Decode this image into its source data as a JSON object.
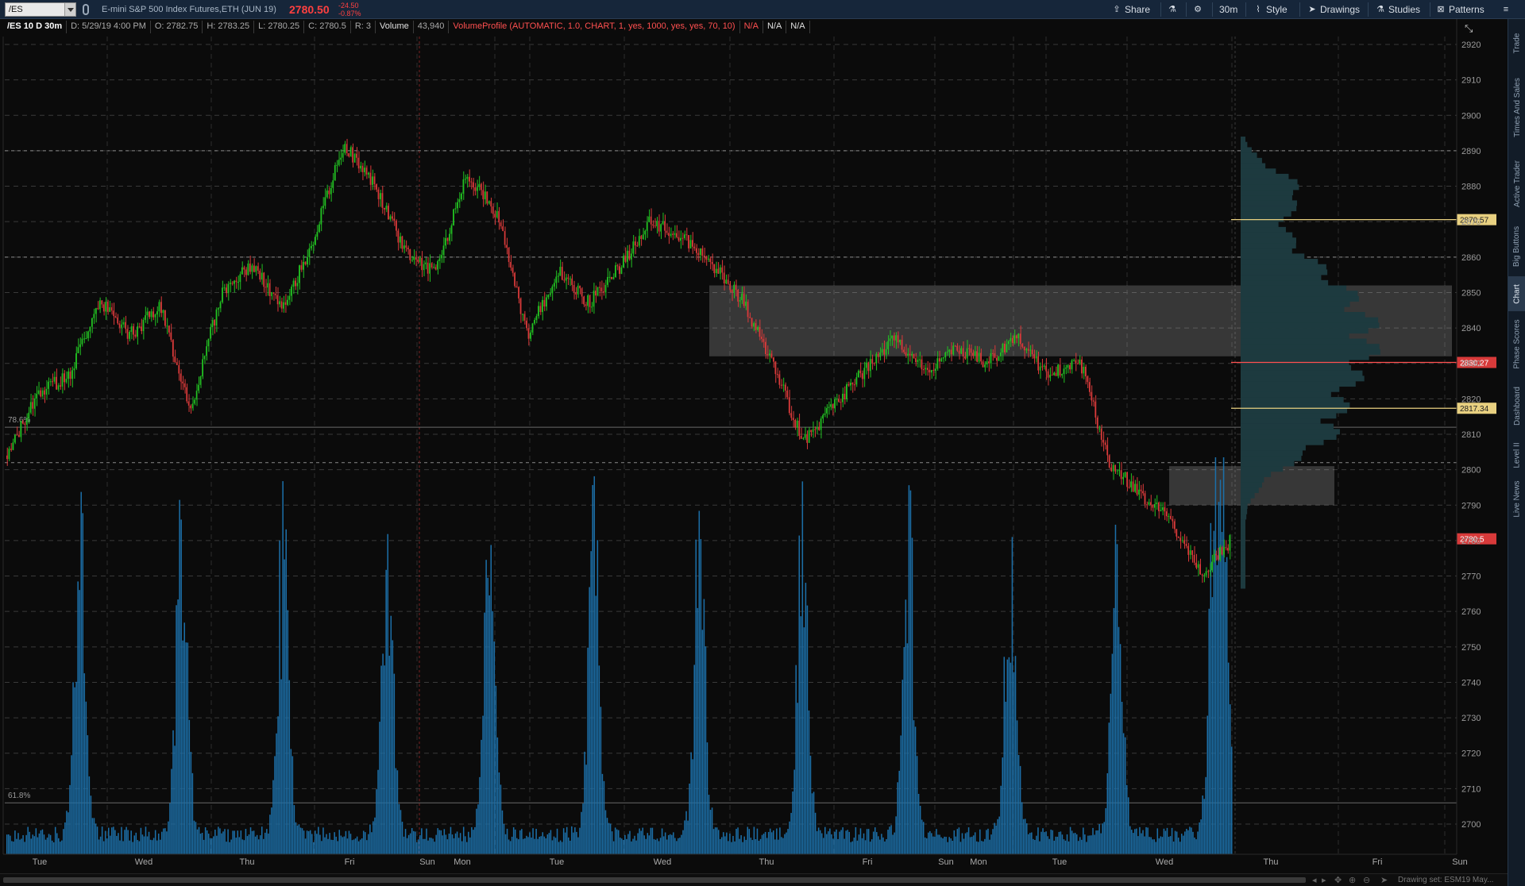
{
  "toolbar": {
    "symbol_input": "/ES",
    "symbol_description": "E-mini S&P 500 Index Futures,ETH (JUN 19)",
    "last_price": "2780.50",
    "net_change": "-24.50",
    "pct_change": "-0.87%",
    "share_label": "Share",
    "timeframe_label": "30m",
    "style_label": "Style",
    "drawings_label": "Drawings",
    "studies_label": "Studies",
    "patterns_label": "Patterns"
  },
  "info_bar": {
    "chart_label": "/ES 10 D 30m",
    "date": "D: 5/29/19 4:00 PM",
    "open": "O: 2782.75",
    "high": "H: 2783.25",
    "low": "L: 2780.25",
    "close": "C: 2780.5",
    "range": "R: 3",
    "volume_label": "Volume",
    "volume_value": "43,940",
    "study_label": "VolumeProfile (AUTOMATIC, 1.0, CHART, 1, yes, 1000, yes, yes, 70, 10)",
    "na_1": "N/A",
    "na_2": "N/A",
    "na_3": "N/A"
  },
  "chart_data": {
    "type": "candlestick",
    "timeframe": "30m",
    "symbol": "/ES",
    "ylim": [
      2690,
      2925
    ],
    "y_ticks": [
      2920,
      2910,
      2900,
      2890,
      2880,
      2870,
      2860,
      2850,
      2840,
      2830,
      2820,
      2810,
      2800,
      2790,
      2780,
      2770,
      2760,
      2750,
      2740,
      2730,
      2720,
      2710,
      2700
    ],
    "x_day_labels": [
      "Tue",
      "Wed",
      "Thu",
      "Fri",
      "Sun",
      "Mon",
      "Tue",
      "Wed",
      "Thu",
      "Fri",
      "Sun",
      "Mon",
      "Tue",
      "Wed",
      "Thu",
      "Fri",
      "Sun"
    ],
    "price_path": [
      {
        "day": "Tue",
        "close": 2804
      },
      {
        "day": "Tue",
        "close": 2822
      },
      {
        "day": "Tue",
        "close": 2826
      },
      {
        "day": "Tue",
        "close": 2848
      },
      {
        "day": "Wed",
        "close": 2838
      },
      {
        "day": "Wed",
        "close": 2846
      },
      {
        "day": "Wed",
        "close": 2817
      },
      {
        "day": "Wed",
        "close": 2850
      },
      {
        "day": "Wed",
        "close": 2858
      },
      {
        "day": "Thu",
        "close": 2845
      },
      {
        "day": "Thu",
        "close": 2865
      },
      {
        "day": "Thu",
        "close": 2892
      },
      {
        "day": "Fri",
        "close": 2880
      },
      {
        "day": "Fri",
        "close": 2862
      },
      {
        "day": "Fri",
        "close": 2855
      },
      {
        "day": "Sun",
        "close": 2884
      },
      {
        "day": "Sun",
        "close": 2872
      },
      {
        "day": "Mon",
        "close": 2838
      },
      {
        "day": "Mon",
        "close": 2856
      },
      {
        "day": "Mon",
        "close": 2847
      },
      {
        "day": "Tue",
        "close": 2857
      },
      {
        "day": "Tue",
        "close": 2870
      },
      {
        "day": "Wed",
        "close": 2866
      },
      {
        "day": "Wed",
        "close": 2858
      },
      {
        "day": "Wed",
        "close": 2848
      },
      {
        "day": "Thu",
        "close": 2830
      },
      {
        "day": "Thu",
        "close": 2808
      },
      {
        "day": "Thu",
        "close": 2818
      },
      {
        "day": "Fri",
        "close": 2828
      },
      {
        "day": "Fri",
        "close": 2837
      },
      {
        "day": "Sun",
        "close": 2828
      },
      {
        "day": "Sun",
        "close": 2834
      },
      {
        "day": "Mon",
        "close": 2830
      },
      {
        "day": "Tue",
        "close": 2838
      },
      {
        "day": "Tue",
        "close": 2826
      },
      {
        "day": "Tue",
        "close": 2832
      },
      {
        "day": "Tue",
        "close": 2802
      },
      {
        "day": "Wed",
        "close": 2793
      },
      {
        "day": "Wed",
        "close": 2786
      },
      {
        "day": "Wed",
        "close": 2770
      },
      {
        "day": "Wed",
        "close": 2780.5
      }
    ],
    "price_labels": [
      {
        "value": 2870.57,
        "text": "2870.57",
        "color": "#e8d080"
      },
      {
        "value": 2830.27,
        "text": "2830.27",
        "color": "#ff5050"
      },
      {
        "value": 2817.34,
        "text": "2817.34",
        "color": "#e8d080"
      },
      {
        "value": 2780.5,
        "text": "2780.5",
        "color": "#ff5050"
      }
    ],
    "fib_levels": [
      {
        "value": 2812,
        "label": "78.6%"
      },
      {
        "value": 2706,
        "label": "61.8%"
      }
    ],
    "shaded_zones": [
      {
        "y_low": 2832,
        "y_high": 2852
      },
      {
        "y_low": 2790,
        "y_high": 2801
      }
    ],
    "volume_profile_color": "#1d3a3f",
    "up_color": "#22c022",
    "down_color": "#d83a3a",
    "volume_color": "#1c6fa8"
  },
  "side_tabs": [
    "Trade",
    "Times And Sales",
    "Active Trader",
    "Big Buttons",
    "Chart",
    "Phase Scores",
    "Dashboard",
    "Level II",
    "Live News"
  ],
  "footer": {
    "drawing_set": "Drawing set: ESM19 May..."
  }
}
